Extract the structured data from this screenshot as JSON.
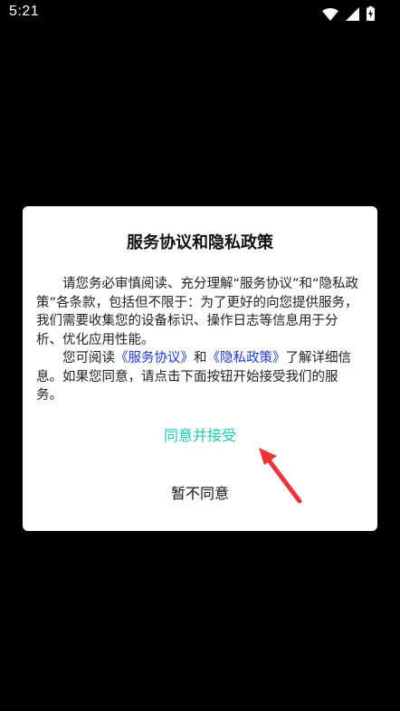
{
  "status_bar": {
    "time": "5:21",
    "icons": [
      "wifi-icon",
      "signal-icon",
      "battery-charging-icon"
    ]
  },
  "dialog": {
    "title": "服务协议和隐私政策",
    "para1": "请您务必审慎阅读、充分理解“服务协议”和“隐私政策”各条款，包括但不限于：为了更好的向您提供服务，我们需要收集您的设备标识、操作日志等信息用于分析、优化应用性能。",
    "para2_before": "您可阅读",
    "link_service": "《服务协议》",
    "and_text": "和",
    "link_privacy": "《隐私政策》",
    "para2_after": "了解详细信息。如果您同意，请点击下面按钮开始接受我们的服务。",
    "accept_label": "同意并接受",
    "decline_label": "暂不同意"
  },
  "colors": {
    "accept": "#1fc7b6",
    "link": "#1e3cc8",
    "arrow": "#e8363a"
  }
}
